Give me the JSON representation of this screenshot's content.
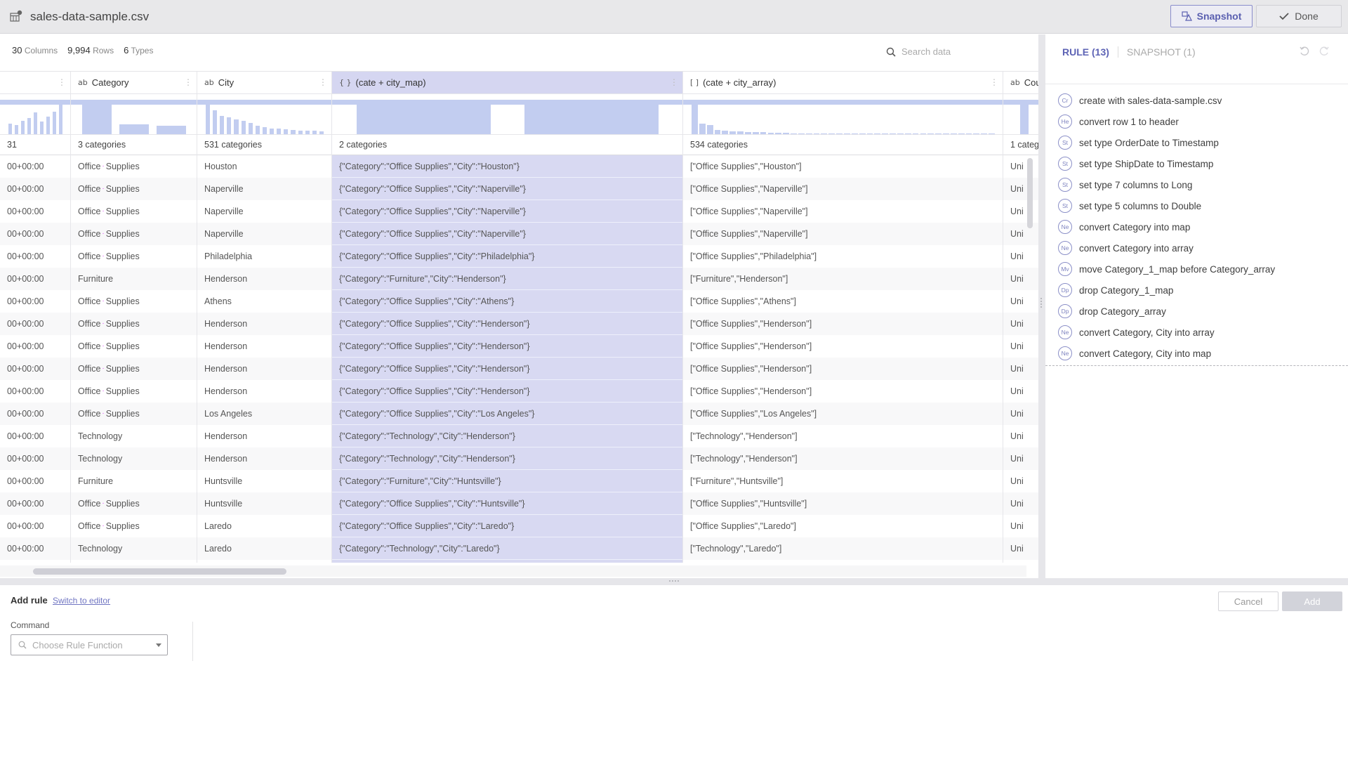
{
  "header": {
    "file_name": "sales-data-sample.csv",
    "snapshot_label": "Snapshot",
    "done_label": "Done"
  },
  "summary": {
    "columns_count": "30",
    "columns_label": "Columns",
    "rows_count": "9,994",
    "rows_label": "Rows",
    "types_count": "6",
    "types_label": "Types"
  },
  "search": {
    "placeholder": "Search data"
  },
  "grid": {
    "columns": [
      {
        "type_icon": "",
        "name": "",
        "categories": "31",
        "hist": [
          0.35,
          0.3,
          0.45,
          0.55,
          0.75,
          0.42,
          0.6,
          0.76,
          1.0
        ]
      },
      {
        "type_icon": "ab",
        "name": "Category",
        "categories": "3 categories",
        "hist": [
          1.0,
          0.33,
          0.29
        ]
      },
      {
        "type_icon": "ab",
        "name": "City",
        "categories": "531 categories",
        "hist": [
          1.0,
          0.8,
          0.62,
          0.58,
          0.5,
          0.45,
          0.38,
          0.28,
          0.24,
          0.2,
          0.18,
          0.17,
          0.15,
          0.13,
          0.12,
          0.11,
          0.1
        ]
      },
      {
        "type_icon": "{ }",
        "name": "(cate + city_map)",
        "categories": "2 categories",
        "hist": [
          1.0,
          1.0
        ],
        "selected": true
      },
      {
        "type_icon": "[ ]",
        "name": "(cate + city_array)",
        "categories": "534 categories",
        "hist": [
          1.0,
          0.35,
          0.3,
          0.15,
          0.12,
          0.1,
          0.09,
          0.08,
          0.07,
          0.06,
          0.05,
          0.04,
          0.04,
          0.03,
          0.03,
          0.03,
          0.02,
          0.02,
          0.02,
          0.02,
          0.02,
          0.02,
          0.02,
          0.02,
          0.02,
          0.02,
          0.02,
          0.02,
          0.02,
          0.02,
          0.02,
          0.02,
          0.02,
          0.02,
          0.02,
          0.02,
          0.02,
          0.02,
          0.02,
          0.02
        ]
      },
      {
        "type_icon": "ab",
        "name": "Cou",
        "categories": "1 categ",
        "hist": [
          1.0
        ]
      }
    ],
    "rows": [
      [
        "00+00:00",
        "Office Supplies",
        "Houston",
        "{\"Category\":\"Office Supplies\",\"City\":\"Houston\"}",
        "[\"Office Supplies\",\"Houston\"]",
        "Uni"
      ],
      [
        "00+00:00",
        "Office Supplies",
        "Naperville",
        "{\"Category\":\"Office Supplies\",\"City\":\"Naperville\"}",
        "[\"Office Supplies\",\"Naperville\"]",
        "Uni"
      ],
      [
        "00+00:00",
        "Office Supplies",
        "Naperville",
        "{\"Category\":\"Office Supplies\",\"City\":\"Naperville\"}",
        "[\"Office Supplies\",\"Naperville\"]",
        "Uni"
      ],
      [
        "00+00:00",
        "Office Supplies",
        "Naperville",
        "{\"Category\":\"Office Supplies\",\"City\":\"Naperville\"}",
        "[\"Office Supplies\",\"Naperville\"]",
        "Uni"
      ],
      [
        "00+00:00",
        "Office Supplies",
        "Philadelphia",
        "{\"Category\":\"Office Supplies\",\"City\":\"Philadelphia\"}",
        "[\"Office Supplies\",\"Philadelphia\"]",
        "Uni"
      ],
      [
        "00+00:00",
        "Furniture",
        "Henderson",
        "{\"Category\":\"Furniture\",\"City\":\"Henderson\"}",
        "[\"Furniture\",\"Henderson\"]",
        "Uni"
      ],
      [
        "00+00:00",
        "Office Supplies",
        "Athens",
        "{\"Category\":\"Office Supplies\",\"City\":\"Athens\"}",
        "[\"Office Supplies\",\"Athens\"]",
        "Uni"
      ],
      [
        "00+00:00",
        "Office Supplies",
        "Henderson",
        "{\"Category\":\"Office Supplies\",\"City\":\"Henderson\"}",
        "[\"Office Supplies\",\"Henderson\"]",
        "Uni"
      ],
      [
        "00+00:00",
        "Office Supplies",
        "Henderson",
        "{\"Category\":\"Office Supplies\",\"City\":\"Henderson\"}",
        "[\"Office Supplies\",\"Henderson\"]",
        "Uni"
      ],
      [
        "00+00:00",
        "Office Supplies",
        "Henderson",
        "{\"Category\":\"Office Supplies\",\"City\":\"Henderson\"}",
        "[\"Office Supplies\",\"Henderson\"]",
        "Uni"
      ],
      [
        "00+00:00",
        "Office Supplies",
        "Henderson",
        "{\"Category\":\"Office Supplies\",\"City\":\"Henderson\"}",
        "[\"Office Supplies\",\"Henderson\"]",
        "Uni"
      ],
      [
        "00+00:00",
        "Office Supplies",
        "Los Angeles",
        "{\"Category\":\"Office Supplies\",\"City\":\"Los Angeles\"}",
        "[\"Office Supplies\",\"Los Angeles\"]",
        "Uni"
      ],
      [
        "00+00:00",
        "Technology",
        "Henderson",
        "{\"Category\":\"Technology\",\"City\":\"Henderson\"}",
        "[\"Technology\",\"Henderson\"]",
        "Uni"
      ],
      [
        "00+00:00",
        "Technology",
        "Henderson",
        "{\"Category\":\"Technology\",\"City\":\"Henderson\"}",
        "[\"Technology\",\"Henderson\"]",
        "Uni"
      ],
      [
        "00+00:00",
        "Furniture",
        "Huntsville",
        "{\"Category\":\"Furniture\",\"City\":\"Huntsville\"}",
        "[\"Furniture\",\"Huntsville\"]",
        "Uni"
      ],
      [
        "00+00:00",
        "Office Supplies",
        "Huntsville",
        "{\"Category\":\"Office Supplies\",\"City\":\"Huntsville\"}",
        "[\"Office Supplies\",\"Huntsville\"]",
        "Uni"
      ],
      [
        "00+00:00",
        "Office Supplies",
        "Laredo",
        "{\"Category\":\"Office Supplies\",\"City\":\"Laredo\"}",
        "[\"Office Supplies\",\"Laredo\"]",
        "Uni"
      ],
      [
        "00+00:00",
        "Technology",
        "Laredo",
        "{\"Category\":\"Technology\",\"City\":\"Laredo\"}",
        "[\"Technology\",\"Laredo\"]",
        "Uni"
      ]
    ]
  },
  "rule_panel": {
    "tab_rule": "RULE (13)",
    "tab_snapshot": "SNAPSHOT (1)",
    "rules": [
      {
        "badge": "Cr",
        "text": "create with sales-data-sample.csv"
      },
      {
        "badge": "He",
        "text": "convert row 1 to header"
      },
      {
        "badge": "St",
        "text": "set type OrderDate to Timestamp"
      },
      {
        "badge": "St",
        "text": "set type ShipDate to Timestamp"
      },
      {
        "badge": "St",
        "text": "set type 7 columns to Long"
      },
      {
        "badge": "St",
        "text": "set type 5 columns to Double"
      },
      {
        "badge": "Ne",
        "text": "convert Category into map"
      },
      {
        "badge": "Ne",
        "text": "convert Category into array"
      },
      {
        "badge": "Mv",
        "text": "move Category_1_map before Category_array"
      },
      {
        "badge": "Dp",
        "text": "drop Category_1_map"
      },
      {
        "badge": "Dp",
        "text": "drop Category_array"
      },
      {
        "badge": "Ne",
        "text": "convert Category, City into array"
      },
      {
        "badge": "Ne",
        "text": "convert Category, City into map"
      }
    ]
  },
  "add_rule": {
    "title": "Add rule",
    "switch_link": "Switch to editor",
    "command_label": "Command",
    "command_placeholder": "Choose Rule Function",
    "cancel_label": "Cancel",
    "add_label": "Add"
  },
  "colors": {
    "accent": "#5d63b5",
    "selected_column": "#d8d9f2",
    "histogram": "#c2cdf0"
  }
}
